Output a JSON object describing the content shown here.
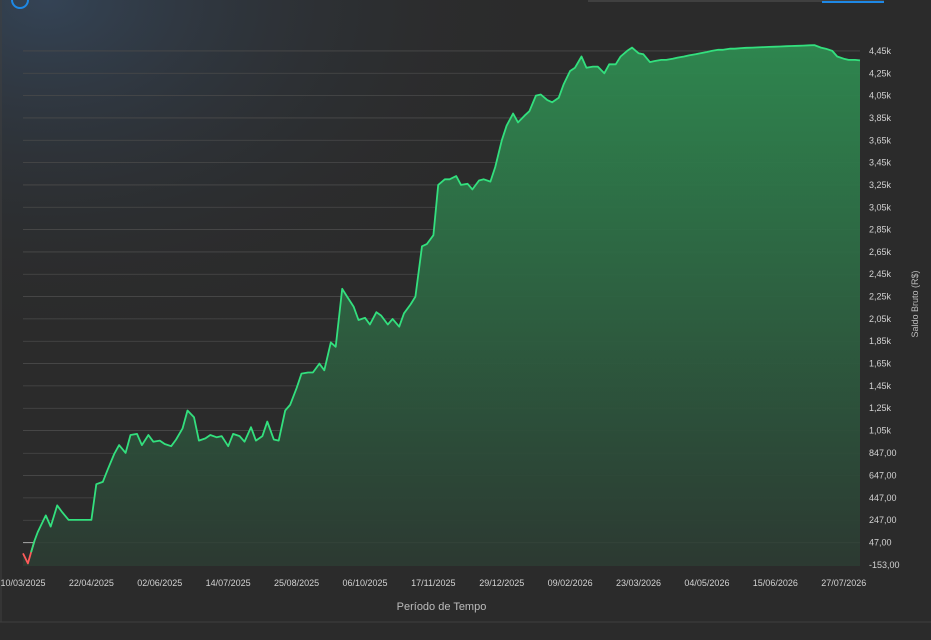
{
  "chart_data": {
    "type": "area",
    "xlabel": "Período de Tempo",
    "ylabel": "Saldo Bruto (R$)",
    "ylim": [
      -163,
      4530
    ],
    "grid": "horizontal",
    "y_ticks": [
      {
        "v": -153,
        "label": "-153,00"
      },
      {
        "v": 47,
        "label": "47,00"
      },
      {
        "v": 247,
        "label": "247,00"
      },
      {
        "v": 447,
        "label": "447,00"
      },
      {
        "v": 647,
        "label": "647,00"
      },
      {
        "v": 847,
        "label": "847,00"
      },
      {
        "v": 1050,
        "label": "1,05k"
      },
      {
        "v": 1250,
        "label": "1,25k"
      },
      {
        "v": 1450,
        "label": "1,45k"
      },
      {
        "v": 1650,
        "label": "1,65k"
      },
      {
        "v": 1850,
        "label": "1,85k"
      },
      {
        "v": 2050,
        "label": "2,05k"
      },
      {
        "v": 2250,
        "label": "2,25k"
      },
      {
        "v": 2450,
        "label": "2,45k"
      },
      {
        "v": 2650,
        "label": "2,65k"
      },
      {
        "v": 2850,
        "label": "2,85k"
      },
      {
        "v": 3050,
        "label": "3,05k"
      },
      {
        "v": 3250,
        "label": "3,25k"
      },
      {
        "v": 3450,
        "label": "3,45k"
      },
      {
        "v": 3650,
        "label": "3,65k"
      },
      {
        "v": 3850,
        "label": "3,85k"
      },
      {
        "v": 4050,
        "label": "4,05k"
      },
      {
        "v": 4250,
        "label": "4,25k"
      },
      {
        "v": 4450,
        "label": "4,45k"
      }
    ],
    "x_ticks": [
      "10/03/2025",
      "22/04/2025",
      "02/06/2025",
      "14/07/2025",
      "25/08/2025",
      "06/10/2025",
      "17/11/2025",
      "29/12/2025",
      "09/02/2026",
      "23/03/2026",
      "04/05/2026",
      "15/06/2026",
      "27/07/2026"
    ],
    "x": [
      "2025-03-10",
      "2025-03-13",
      "2025-03-15",
      "2025-03-17",
      "2025-03-19",
      "2025-03-21",
      "2025-03-24",
      "2025-03-27",
      "2025-03-31",
      "2025-04-03",
      "2025-04-07",
      "2025-04-10",
      "2025-04-14",
      "2025-04-17",
      "2025-04-21",
      "2025-04-24",
      "2025-04-28",
      "2025-05-01",
      "2025-05-05",
      "2025-05-08",
      "2025-05-12",
      "2025-05-15",
      "2025-05-19",
      "2025-05-22",
      "2025-05-26",
      "2025-05-29",
      "2025-06-02",
      "2025-06-05",
      "2025-06-09",
      "2025-06-12",
      "2025-06-16",
      "2025-06-19",
      "2025-06-23",
      "2025-06-26",
      "2025-06-30",
      "2025-07-03",
      "2025-07-07",
      "2025-07-10",
      "2025-07-14",
      "2025-07-17",
      "2025-07-21",
      "2025-07-24",
      "2025-07-28",
      "2025-07-31",
      "2025-08-04",
      "2025-08-07",
      "2025-08-11",
      "2025-08-14",
      "2025-08-18",
      "2025-08-21",
      "2025-08-25",
      "2025-08-28",
      "2025-09-01",
      "2025-09-04",
      "2025-09-08",
      "2025-09-11",
      "2025-09-15",
      "2025-09-18",
      "2025-09-22",
      "2025-09-25",
      "2025-09-29",
      "2025-10-02",
      "2025-10-06",
      "2025-10-09",
      "2025-10-13",
      "2025-10-16",
      "2025-10-20",
      "2025-10-23",
      "2025-10-27",
      "2025-10-30",
      "2025-11-03",
      "2025-11-06",
      "2025-11-10",
      "2025-11-13",
      "2025-11-17",
      "2025-11-20",
      "2025-11-24",
      "2025-11-27",
      "2025-12-01",
      "2025-12-04",
      "2025-12-08",
      "2025-12-11",
      "2025-12-15",
      "2025-12-18",
      "2025-12-22",
      "2025-12-25",
      "2025-12-29",
      "2026-01-01",
      "2026-01-05",
      "2026-01-08",
      "2026-01-12",
      "2026-01-15",
      "2026-01-19",
      "2026-01-22",
      "2026-01-26",
      "2026-01-29",
      "2026-02-02",
      "2026-02-05",
      "2026-02-09",
      "2026-02-12",
      "2026-02-16",
      "2026-02-19",
      "2026-02-23",
      "2026-02-26",
      "2026-03-02",
      "2026-03-05",
      "2026-03-09",
      "2026-03-12",
      "2026-03-16",
      "2026-03-19",
      "2026-03-23",
      "2026-03-26",
      "2026-03-30",
      "2026-04-02",
      "2026-04-06",
      "2026-04-09",
      "2026-04-13",
      "2026-04-16",
      "2026-04-20",
      "2026-04-23",
      "2026-04-27",
      "2026-04-30",
      "2026-05-04",
      "2026-05-07",
      "2026-05-11",
      "2026-05-14",
      "2026-05-18",
      "2026-05-21",
      "2026-05-25",
      "2026-05-28",
      "2026-06-01",
      "2026-06-04",
      "2026-06-08",
      "2026-06-11",
      "2026-06-15",
      "2026-06-18",
      "2026-06-22",
      "2026-06-25",
      "2026-06-29",
      "2026-07-02",
      "2026-07-06",
      "2026-07-09",
      "2026-07-13",
      "2026-07-16",
      "2026-07-20",
      "2026-07-23",
      "2026-07-27",
      "2026-07-30",
      "2026-08-03",
      "2026-08-06"
    ],
    "values": [
      -50,
      -140,
      -40,
      60,
      140,
      200,
      290,
      190,
      380,
      320,
      250,
      250,
      250,
      250,
      250,
      570,
      590,
      700,
      840,
      920,
      850,
      1010,
      1020,
      920,
      1010,
      950,
      960,
      930,
      910,
      970,
      1070,
      1230,
      1170,
      960,
      980,
      1010,
      990,
      1000,
      910,
      1020,
      1000,
      950,
      1080,
      960,
      1000,
      1130,
      970,
      960,
      1230,
      1280,
      1430,
      1560,
      1570,
      1570,
      1650,
      1590,
      1840,
      1800,
      2320,
      2250,
      2160,
      2040,
      2060,
      2000,
      2110,
      2080,
      2000,
      2050,
      1980,
      2100,
      2180,
      2250,
      2700,
      2720,
      2800,
      3250,
      3300,
      3300,
      3330,
      3250,
      3260,
      3210,
      3290,
      3300,
      3280,
      3410,
      3650,
      3780,
      3890,
      3810,
      3870,
      3910,
      4050,
      4060,
      4010,
      3990,
      4030,
      4150,
      4270,
      4300,
      4400,
      4300,
      4310,
      4310,
      4250,
      4330,
      4330,
      4400,
      4450,
      4480,
      4430,
      4420,
      4350,
      4360,
      4370,
      4370,
      4380,
      4390,
      4400,
      4410,
      4420,
      4430,
      4440,
      4450,
      4460,
      4460,
      4470,
      4470,
      4475,
      4478,
      4480,
      4482,
      4484,
      4486,
      4488,
      4490,
      4492,
      4494,
      4496,
      4498,
      4500,
      4502,
      4480,
      4470,
      4450,
      4400,
      4380,
      4370,
      4370,
      4365
    ],
    "series": [
      {
        "name": "Saldo Bruto (R$)"
      }
    ]
  },
  "colors": {
    "line_positive": "#33e07e",
    "line_negative": "#ff5a5a",
    "fill_top": "#2e8a50",
    "fill_bottom": "#2c3a32",
    "grid": "#4a4a4a",
    "baseline": "#9a9a9a",
    "background": "#2b2b2b",
    "accent": "#1e88e5"
  }
}
